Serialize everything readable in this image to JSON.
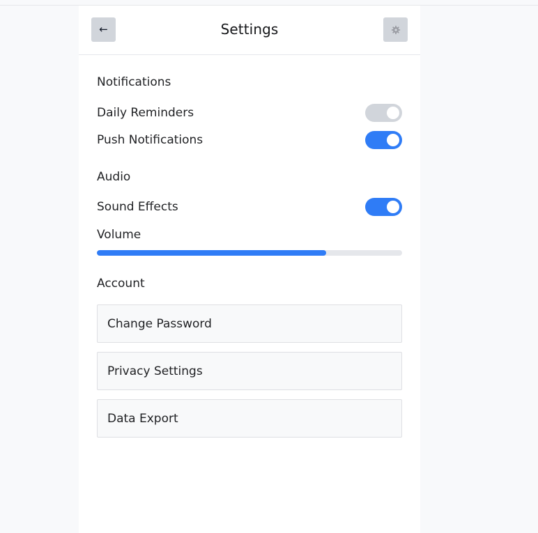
{
  "header": {
    "title": "Settings",
    "back_symbol": "←",
    "back_icon": "back-arrow-icon",
    "settings_icon": "gear-icon"
  },
  "sections": {
    "notifications": {
      "label": "Notifications",
      "items": [
        {
          "label": "Daily Reminders",
          "enabled": false
        },
        {
          "label": "Push Notifications",
          "enabled": true
        }
      ]
    },
    "audio": {
      "label": "Audio",
      "sound_effects": {
        "label": "Sound Effects",
        "enabled": true
      },
      "volume": {
        "label": "Volume",
        "value_percent": 75
      }
    },
    "account": {
      "label": "Account",
      "items": [
        "Change Password",
        "Privacy Settings",
        "Data Export"
      ]
    }
  },
  "colors": {
    "accent": "#2f7cf6",
    "toggle_off": "#d1d5db",
    "track": "#e5e7eb"
  }
}
